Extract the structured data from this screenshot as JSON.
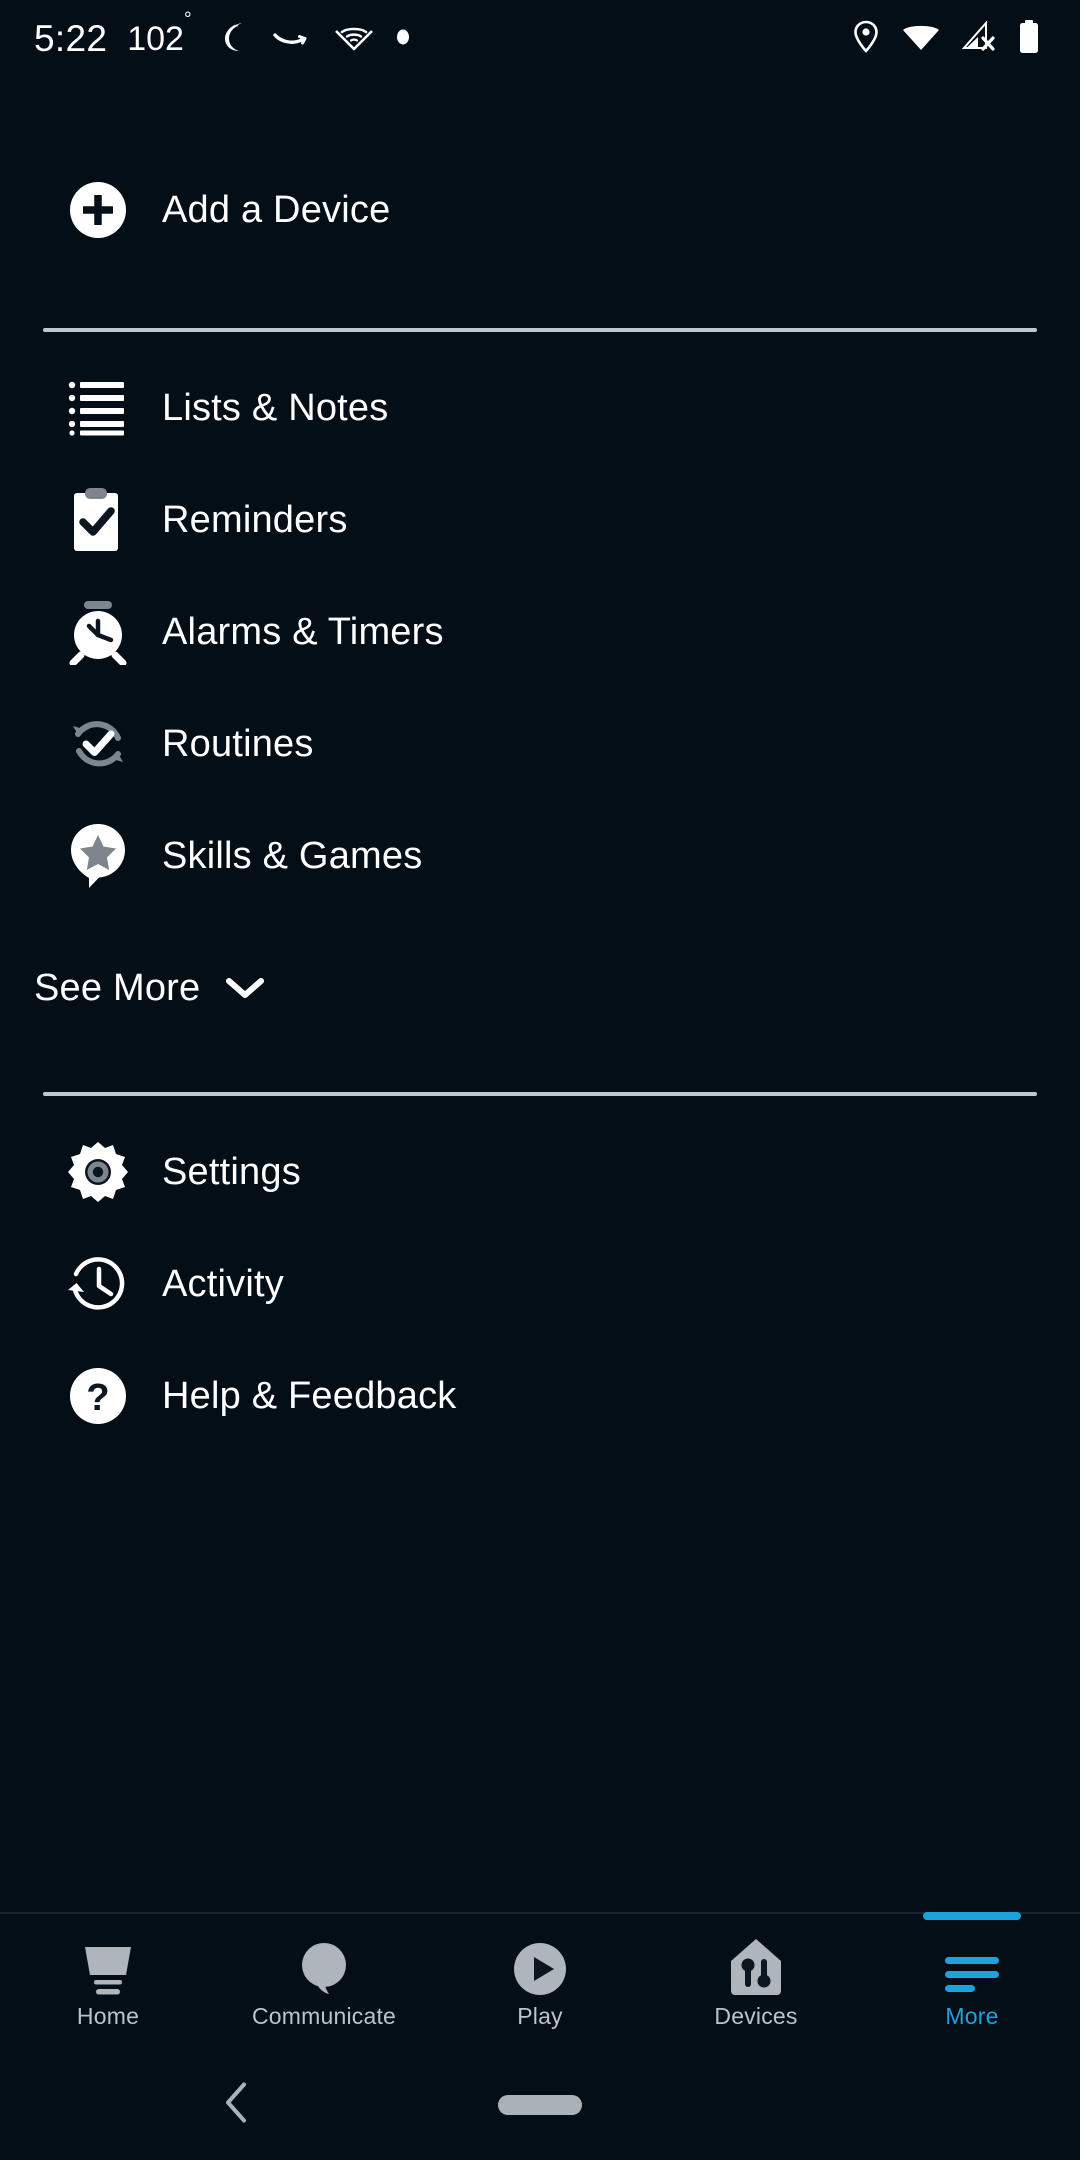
{
  "status_bar": {
    "time": "5:22",
    "temperature": "102",
    "degree_symbol": "°",
    "left_icons": [
      "dnd-moon-icon",
      "amazon-icon",
      "audible-icon",
      "notification-dot-icon"
    ],
    "right_icons": [
      "location-pin-icon",
      "wifi-icon",
      "cellular-no-signal-icon",
      "battery-icon"
    ]
  },
  "menu": {
    "add_device": {
      "label": "Add a Device",
      "icon": "plus-circle-icon"
    },
    "primary_items": [
      {
        "label": "Lists & Notes",
        "icon": "bulleted-list-icon"
      },
      {
        "label": "Reminders",
        "icon": "clipboard-check-icon"
      },
      {
        "label": "Alarms & Timers",
        "icon": "alarm-clock-icon"
      },
      {
        "label": "Routines",
        "icon": "routines-refresh-check-icon"
      },
      {
        "label": "Skills & Games",
        "icon": "skills-star-pin-icon"
      }
    ],
    "see_more": {
      "label": "See More",
      "icon": "chevron-down-icon"
    },
    "secondary_items": [
      {
        "label": "Settings",
        "icon": "gear-icon"
      },
      {
        "label": "Activity",
        "icon": "clock-history-icon"
      },
      {
        "label": "Help & Feedback",
        "icon": "question-circle-icon"
      }
    ]
  },
  "tab_bar": {
    "active_index": 4,
    "accent_color": "#1ca2dd",
    "inactive_color": "#bcc3c9",
    "tabs": [
      {
        "label": "Home",
        "icon": "echo-device-icon"
      },
      {
        "label": "Communicate",
        "icon": "speech-bubble-icon"
      },
      {
        "label": "Play",
        "icon": "play-circle-icon"
      },
      {
        "label": "Devices",
        "icon": "house-sliders-icon"
      },
      {
        "label": "More",
        "icon": "hamburger-menu-icon"
      }
    ]
  },
  "system_nav": {
    "back": "back-chevron-icon",
    "home": "home-pill-icon"
  }
}
